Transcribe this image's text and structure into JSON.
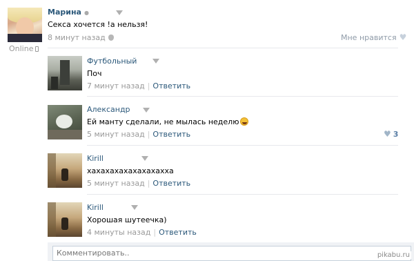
{
  "post": {
    "author": "Марина",
    "text": "Секса хочется !а нельзя!",
    "time": "8 минут назад",
    "status": "Online",
    "like_label": "Мне нравится"
  },
  "comments": [
    {
      "author": "Футбольный",
      "text": "Поч",
      "time": "7 минут назад",
      "reply": "Ответить",
      "likes": ""
    },
    {
      "author": "Александр",
      "text": "Ей манту сделали, не мылась неделю",
      "time": "5 минут назад",
      "reply": "Ответить",
      "likes": "3"
    },
    {
      "author": "Kirill",
      "text": "хахахахахахахахахха",
      "time": "5 минут назад",
      "reply": "Ответить",
      "likes": ""
    },
    {
      "author": "Kirill",
      "text": "Хорошая шутеечка)",
      "time": "4 минуты назад",
      "reply": "Ответить",
      "likes": ""
    }
  ],
  "comment_box": {
    "placeholder": "Комментировать.."
  },
  "watermark": "pikabu.ru",
  "icons": [
    "dropdown-icon",
    "phone-icon",
    "apple-icon",
    "heart-icon",
    "emoji-laugh-icon"
  ],
  "colors": {
    "link": "#2b587a",
    "meta": "#999999",
    "divider": "#e7e8ec",
    "input_border": "#c5d0db"
  }
}
